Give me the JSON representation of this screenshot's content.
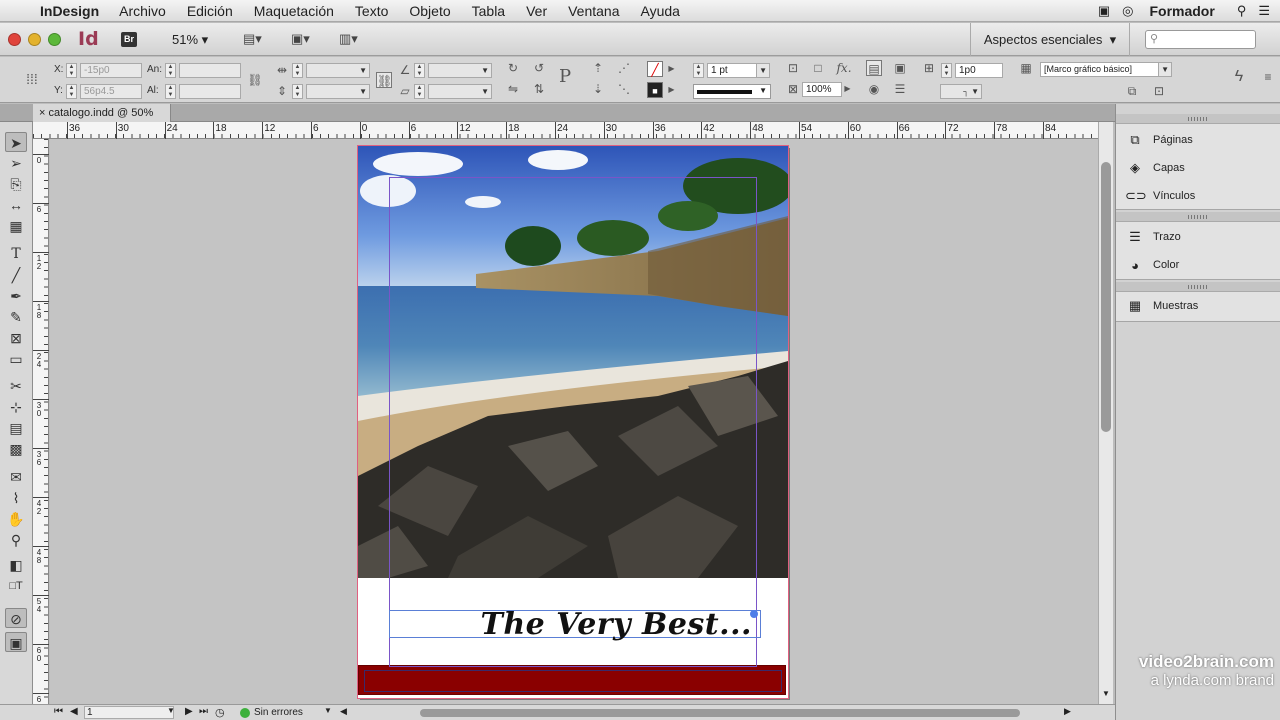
{
  "menubar": {
    "app": "InDesign",
    "items": [
      "Archivo",
      "Edición",
      "Maquetación",
      "Texto",
      "Objeto",
      "Tabla",
      "Ver",
      "Ventana",
      "Ayuda"
    ],
    "workspace_label": "Formador"
  },
  "appbar": {
    "logo": "Id",
    "bridge": "Br",
    "zoom": "51%",
    "workspace": "Aspectos esenciales"
  },
  "control": {
    "x_label": "X:",
    "x_value": "-15p0",
    "y_label": "Y:",
    "y_value": "56p4.5",
    "w_label": "An:",
    "h_label": "Al:",
    "stroke_weight": "1 pt",
    "gap_value": "1p0",
    "opacity": "100%",
    "object_style": "[Marco gráfico básico]"
  },
  "tab": {
    "title": "catalogo.indd @ 50%"
  },
  "ruler_h": [
    "36",
    "30",
    "24",
    "18",
    "12",
    "6",
    "0",
    "6",
    "12",
    "18",
    "24",
    "30",
    "36",
    "42",
    "48",
    "54",
    "60",
    "66",
    "72",
    "78",
    "84"
  ],
  "ruler_v": [
    "0",
    "6",
    "12",
    "18",
    "24",
    "30",
    "36",
    "42",
    "48",
    "54",
    "60",
    "6"
  ],
  "document": {
    "headline": "The Very Best..."
  },
  "status": {
    "page": "1",
    "preflight": "Sin errores"
  },
  "panels": {
    "group1": [
      "Páginas",
      "Capas",
      "Vínculos"
    ],
    "group2": [
      "Trazo",
      "Color"
    ],
    "group3": [
      "Muestras"
    ]
  },
  "watermark": {
    "line1": "video2brain.com",
    "line2": "a lynda.com brand"
  },
  "colors": {
    "accent_red": "#8a0000",
    "bleed": "#e06080",
    "margin": "#7a55c8",
    "frame": "#5a7fd6"
  }
}
